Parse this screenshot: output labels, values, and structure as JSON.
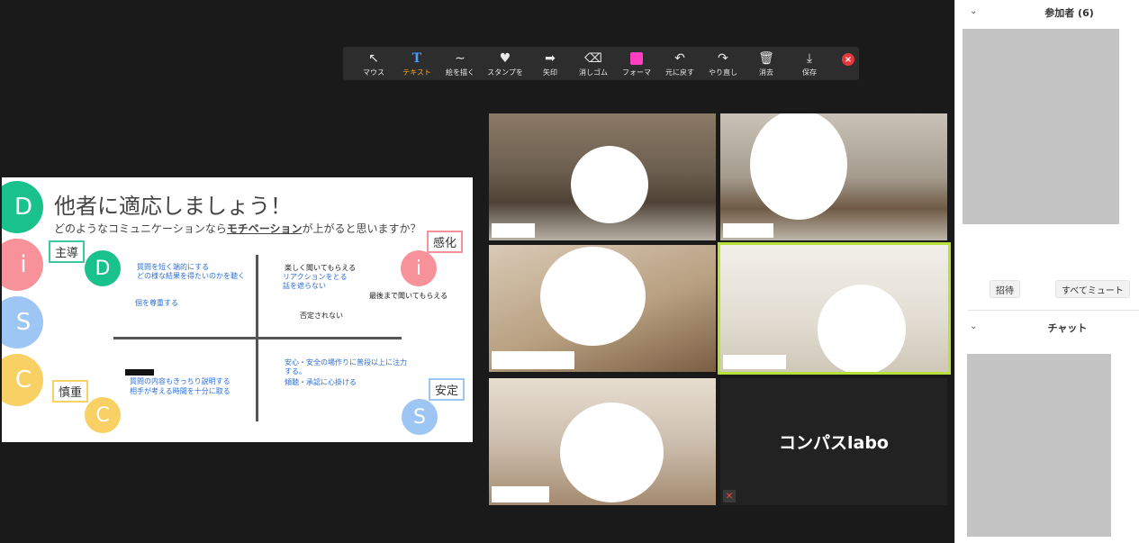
{
  "toolbar": {
    "tools": [
      {
        "label": "マウス",
        "icon": "↖"
      },
      {
        "label": "テキスト",
        "icon": "T"
      },
      {
        "label": "絵を描く",
        "icon": "∼"
      },
      {
        "label": "スタンプを",
        "icon": "♥"
      },
      {
        "label": "矢印",
        "icon": "➡"
      },
      {
        "label": "消しゴム",
        "icon": "⌫"
      },
      {
        "label": "フォーマ",
        "icon": "■"
      },
      {
        "label": "元に戻す",
        "icon": "↶"
      },
      {
        "label": "やり直し",
        "icon": "↷"
      },
      {
        "label": "消去",
        "icon": "🗑"
      },
      {
        "label": "保存",
        "icon": "⤓"
      }
    ],
    "active_color": "#f6a623",
    "format_color": "#ff3fc0"
  },
  "slide": {
    "title": "他者に適応しましょう！",
    "subtitle_pre": "どのようなコミュニケーションなら",
    "subtitle_em": "モチベーション",
    "subtitle_post": "が上がると思いますか？",
    "letters": [
      "D",
      "i",
      "S",
      "C"
    ],
    "labels": {
      "dominant": "主導",
      "influence": "感化",
      "cautious": "慎重",
      "steady": "安定"
    },
    "colors": {
      "D": "#18c28a",
      "i": "#f7929a",
      "S": "#9ec6f5",
      "C": "#f8d064"
    },
    "notes": {
      "d1": "質問を短く端的にする",
      "d2": "どの様な結果を得たいのかを聴く",
      "d3": "個を尊重する",
      "i1": "楽しく聞いてもらえる",
      "i2": "リアクションをとる",
      "i3": "話を遮らない",
      "i4": "最後まで聞いてもらえる",
      "i5": "否定されない",
      "s1": "安心・安全の場作りに普段以上に注力",
      "s2": "する。",
      "s3": "傾聴・承認に心掛ける",
      "c1": "質問の内容もきっちり説明する",
      "c2": "相手が考える時間を十分に取る"
    }
  },
  "video": {
    "tile6_name": "コンパスlabo"
  },
  "side": {
    "participants_title": "参加者 (6)",
    "invite": "招待",
    "mute_all": "すべてミュート",
    "chat_title": "チャット"
  }
}
